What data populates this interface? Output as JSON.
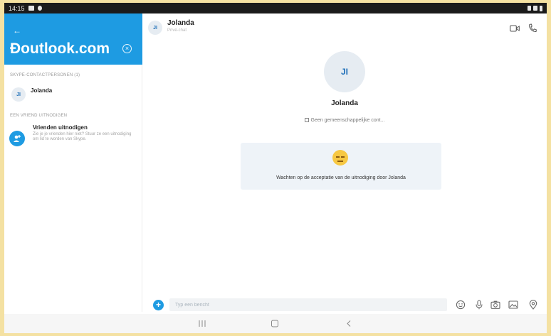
{
  "status_bar": {
    "time": "14:15"
  },
  "sidebar": {
    "search_value": "Ɖoutlook.com",
    "section_contacts": "SKYPE-CONTACTPERSONEN (1)",
    "contact": {
      "initials": "JI",
      "name": "Jolanda"
    },
    "section_invite": "EEN VRIEND UITNODIGEN",
    "invite": {
      "title": "Vrienden uitnodigen",
      "description": "Zie je je vrienden hier niet? Stuur ze een uitnodiging om lid te worden van Skype."
    }
  },
  "conversation": {
    "header": {
      "initials": "JI",
      "name": "Jolanda",
      "subtitle": "Privé-chat"
    },
    "profile": {
      "initials": "JI",
      "name": "Jolanda",
      "mutual_contacts": "Geen gemeenschappelijke cont..."
    },
    "pending_message": "Wachten op de acceptatie van de uitnodiging door Jolanda",
    "composer": {
      "placeholder": "Typ een bericht"
    }
  },
  "colors": {
    "accent": "#1e9be2",
    "card": "#eef3f8",
    "frame": "#f4e1a2"
  },
  "icons": [
    "back-arrow-icon",
    "clear-icon",
    "add-contact-icon",
    "video-call-icon",
    "audio-call-icon",
    "emoji-face-icon",
    "plus-icon",
    "emoji-icon",
    "microphone-icon",
    "camera-icon",
    "image-icon",
    "location-icon",
    "recent-apps-icon",
    "home-icon",
    "back-icon"
  ]
}
